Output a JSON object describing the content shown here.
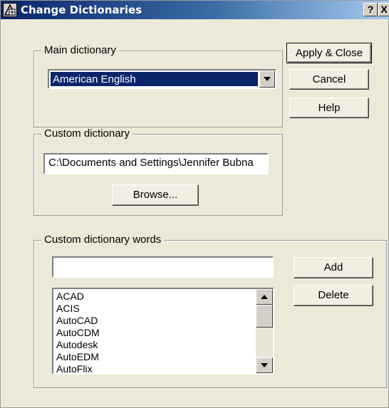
{
  "window": {
    "title": "Change Dictionaries",
    "help_label": "?",
    "close_label": "X"
  },
  "main_dictionary": {
    "group_label": "Main dictionary",
    "selected": "American English"
  },
  "custom_dictionary": {
    "group_label": "Custom dictionary",
    "path": "C:\\Documents and Settings\\Jennifer Bubna",
    "browse_label": "Browse..."
  },
  "buttons": {
    "apply_close": "Apply & Close",
    "cancel": "Cancel",
    "help": "Help"
  },
  "custom_words": {
    "group_label": "Custom dictionary words",
    "input_value": "",
    "add_label": "Add",
    "delete_label": "Delete",
    "items": [
      "ACAD",
      "ACIS",
      "AutoCAD",
      "AutoCDM",
      "Autodesk",
      "AutoEDM",
      "AutoFlix"
    ]
  },
  "icons": {
    "title": "dictionary-app-icon",
    "dropdown": "triangle-down-icon",
    "scroll_up": "triangle-up-icon",
    "scroll_down": "triangle-down-icon"
  }
}
